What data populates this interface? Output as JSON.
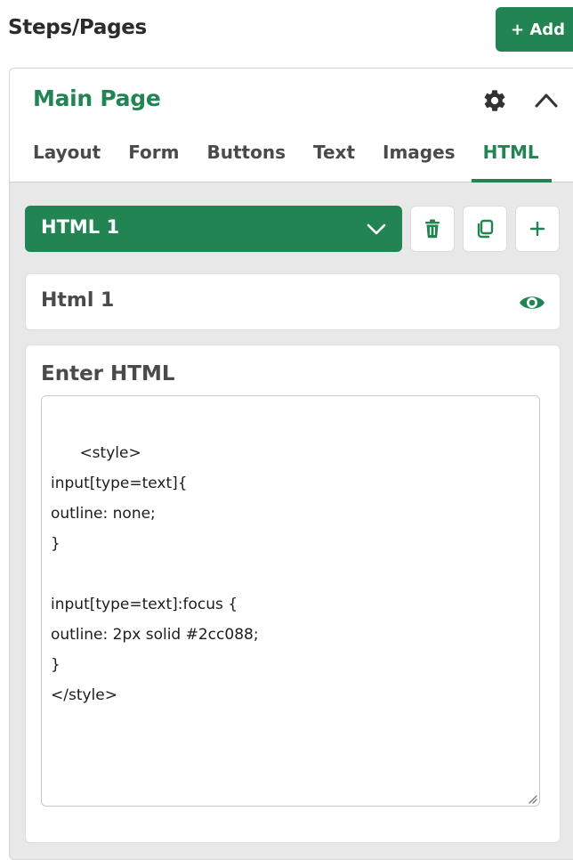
{
  "header": {
    "title": "Steps/Pages",
    "add_label": "+ Add"
  },
  "panel": {
    "title": "Main Page",
    "tabs": [
      {
        "label": "Layout",
        "active": false
      },
      {
        "label": "Form",
        "active": false
      },
      {
        "label": "Buttons",
        "active": false
      },
      {
        "label": "Text",
        "active": false
      },
      {
        "label": "Images",
        "active": false
      },
      {
        "label": "HTML",
        "active": true
      }
    ]
  },
  "html_selector": {
    "selected": "HTML 1"
  },
  "html_item": {
    "name": "Html 1"
  },
  "editor": {
    "label": "Enter HTML",
    "code": "<style>\ninput[type=text]{\noutline: none;\n}\n\ninput[type=text]:focus {\noutline: 2px solid #2cc088;\n}\n</style>"
  },
  "colors": {
    "accent": "#228453",
    "background": "#e8e8e8"
  },
  "icons": [
    "gear-icon",
    "chevron-up-icon",
    "chevron-down-icon",
    "trash-icon",
    "copy-icon",
    "plus-icon",
    "eye-icon",
    "resize-grip-icon"
  ]
}
